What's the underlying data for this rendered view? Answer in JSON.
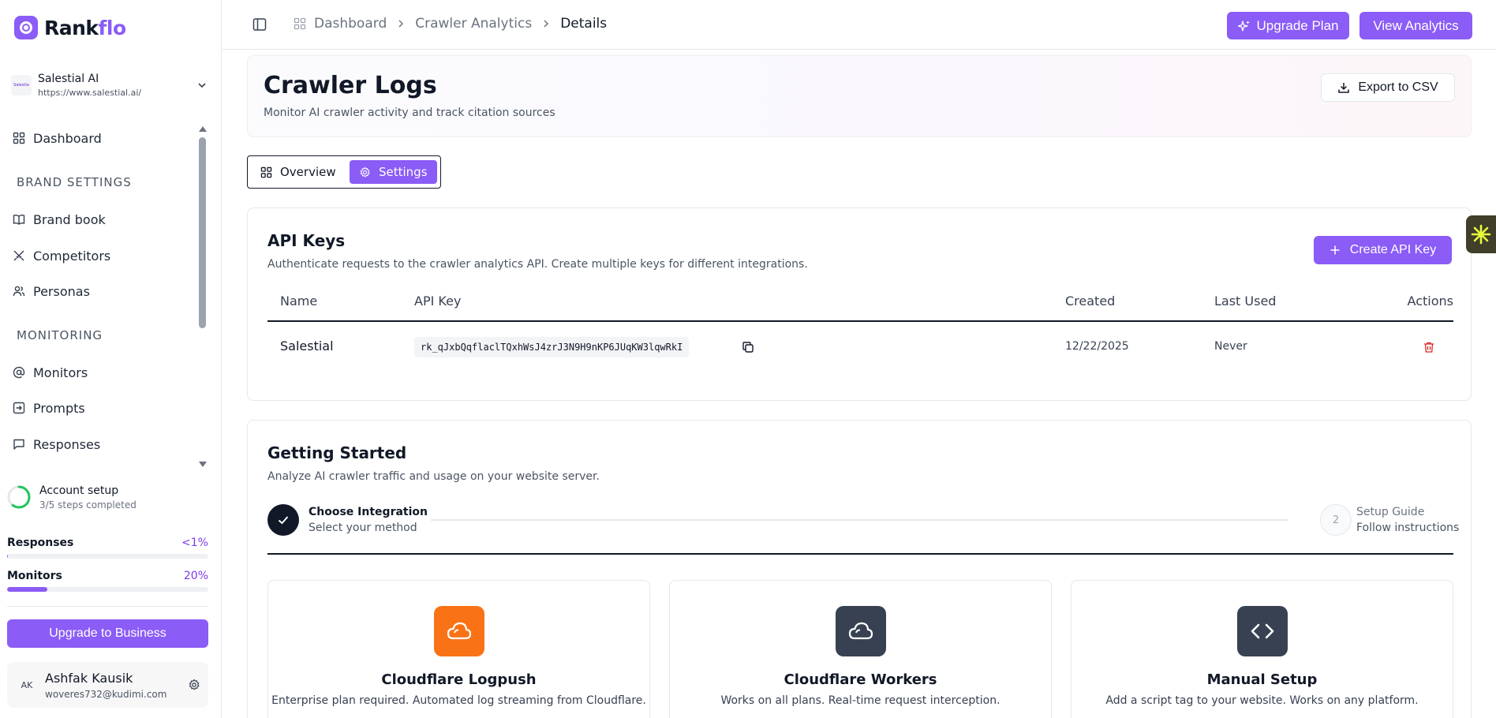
{
  "brand": {
    "name_part1": "Rank",
    "name_part2": "flo",
    "accent": "#8b5cf6"
  },
  "workspace": {
    "logo_text": "Salestia",
    "name": "Salestial AI",
    "url": "https://www.salestial.ai/"
  },
  "sidebar": {
    "dashboard": "Dashboard",
    "section_brand": "BRAND SETTINGS",
    "brand_book": "Brand book",
    "competitors": "Competitors",
    "personas": "Personas",
    "section_monitoring": "MONITORING",
    "monitors": "Monitors",
    "prompts": "Prompts",
    "responses": "Responses"
  },
  "account_setup": {
    "title": "Account setup",
    "progress": "3/5 steps completed",
    "completed": 3,
    "total": 5
  },
  "usage": [
    {
      "label": "Responses",
      "percent_label": "<1%",
      "fraction": 0.005
    },
    {
      "label": "Monitors",
      "percent_label": "20%",
      "fraction": 0.2
    }
  ],
  "upgrade_business": "Upgrade to Business",
  "user": {
    "initials": "AK",
    "name": "Ashfak Kausik",
    "email": "woveres732@kudimi.com"
  },
  "breadcrumb": {
    "item1": "Dashboard",
    "item2": "Crawler Analytics",
    "item3": "Details"
  },
  "topbar": {
    "upgrade_plan": "Upgrade Plan",
    "view_analytics": "View Analytics"
  },
  "hero": {
    "title": "Crawler Logs",
    "subtitle": "Monitor AI crawler activity and track citation sources",
    "export": "Export to CSV"
  },
  "tabs": {
    "overview": "Overview",
    "settings": "Settings"
  },
  "api_keys": {
    "title": "API Keys",
    "description": "Authenticate requests to the crawler analytics API. Create multiple keys for different integrations.",
    "create": "Create API Key",
    "columns": {
      "name": "Name",
      "api_key": "API Key",
      "created": "Created",
      "last_used": "Last Used",
      "actions": "Actions"
    },
    "rows": [
      {
        "name": "Salestial",
        "key": "rk_qJxbQqflaclTQxhWsJ4zrJ3N9H9nKP6JUqKW3lqwRkI",
        "created": "12/22/2025",
        "last_used": "Never"
      }
    ]
  },
  "getting_started": {
    "title": "Getting Started",
    "description": "Analyze AI crawler traffic and usage on your website server.",
    "step1": {
      "title": "Choose Integration",
      "sub": "Select your method"
    },
    "step2": {
      "number": "2",
      "title": "Setup Guide",
      "sub": "Follow instructions"
    },
    "integrations": [
      {
        "title": "Cloudflare Logpush",
        "desc": "Enterprise plan required. Automated log streaming from Cloudflare.",
        "color": "#f97316",
        "icon": "cloud-icon"
      },
      {
        "title": "Cloudflare Workers",
        "desc": "Works on all plans. Real-time request interception.",
        "color": "#374151",
        "icon": "cloud-icon"
      },
      {
        "title": "Manual Setup",
        "desc": "Add a script tag to your website. Works on any platform.",
        "color": "#374151",
        "icon": "code-icon"
      }
    ]
  }
}
